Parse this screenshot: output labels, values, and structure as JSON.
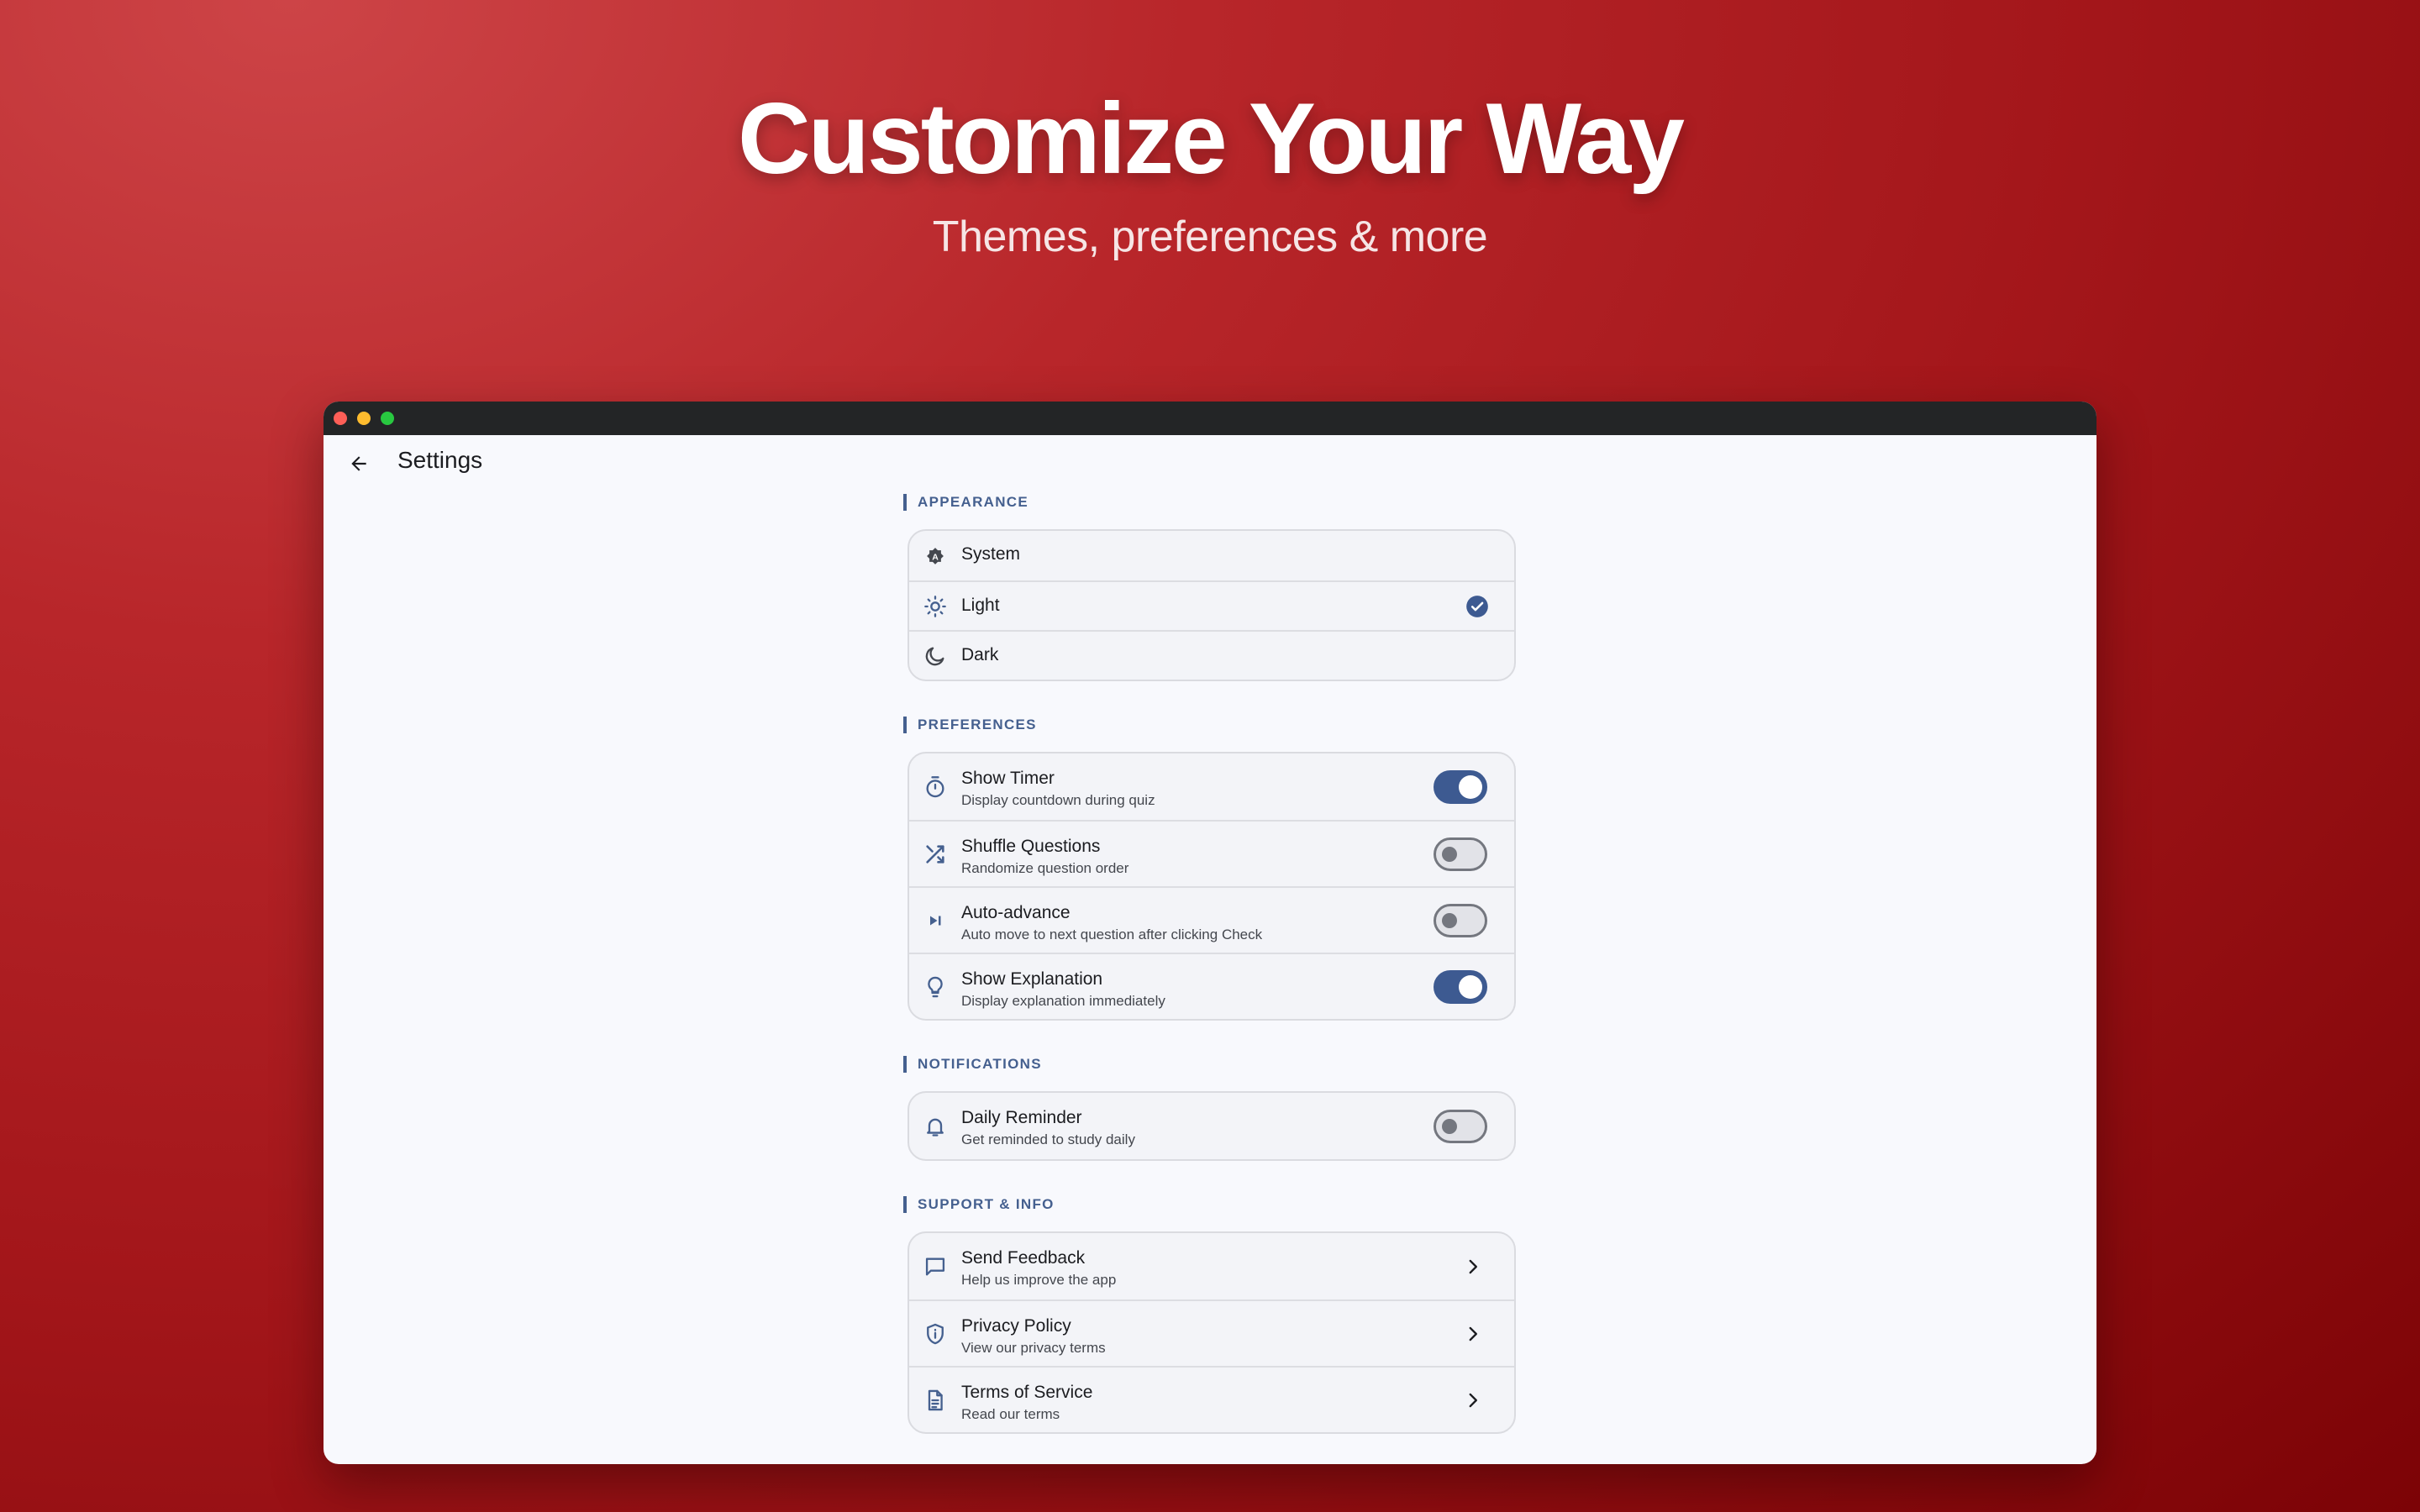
{
  "hero": {
    "title": "Customize Your Way",
    "subtitle": "Themes, preferences & more"
  },
  "appbar": {
    "back_icon": "arrow-back-icon",
    "title": "Settings"
  },
  "appearance": {
    "label": "APPEARANCE",
    "options": [
      {
        "label": "System",
        "icon": "auto-brightness-icon",
        "selected": false
      },
      {
        "label": "Light",
        "icon": "sun-icon",
        "selected": true
      },
      {
        "label": "Dark",
        "icon": "moon-icon",
        "selected": false
      }
    ]
  },
  "preferences": {
    "label": "PREFERENCES",
    "items": [
      {
        "title": "Show Timer",
        "subtitle": "Display countdown during quiz",
        "icon": "timer-icon",
        "on": true
      },
      {
        "title": "Shuffle Questions",
        "subtitle": "Randomize question order",
        "icon": "shuffle-icon",
        "on": false
      },
      {
        "title": "Auto-advance",
        "subtitle": "Auto move to next question after clicking Check",
        "icon": "skip-next-icon",
        "on": false
      },
      {
        "title": "Show Explanation",
        "subtitle": "Display explanation immediately",
        "icon": "lightbulb-icon",
        "on": true
      }
    ]
  },
  "notifications": {
    "label": "NOTIFICATIONS",
    "items": [
      {
        "title": "Daily Reminder",
        "subtitle": "Get reminded to study daily",
        "icon": "bell-icon",
        "on": false
      }
    ]
  },
  "support": {
    "label": "SUPPORT & INFO",
    "items": [
      {
        "title": "Send Feedback",
        "subtitle": "Help us improve the app",
        "icon": "feedback-icon"
      },
      {
        "title": "Privacy Policy",
        "subtitle": "View our privacy terms",
        "icon": "shield-icon"
      },
      {
        "title": "Terms of Service",
        "subtitle": "Read our terms",
        "icon": "document-icon"
      }
    ]
  },
  "colors": {
    "accent": "#3d5a91",
    "background_red": "#a3161a",
    "window_bg": "#f8f9fd"
  }
}
